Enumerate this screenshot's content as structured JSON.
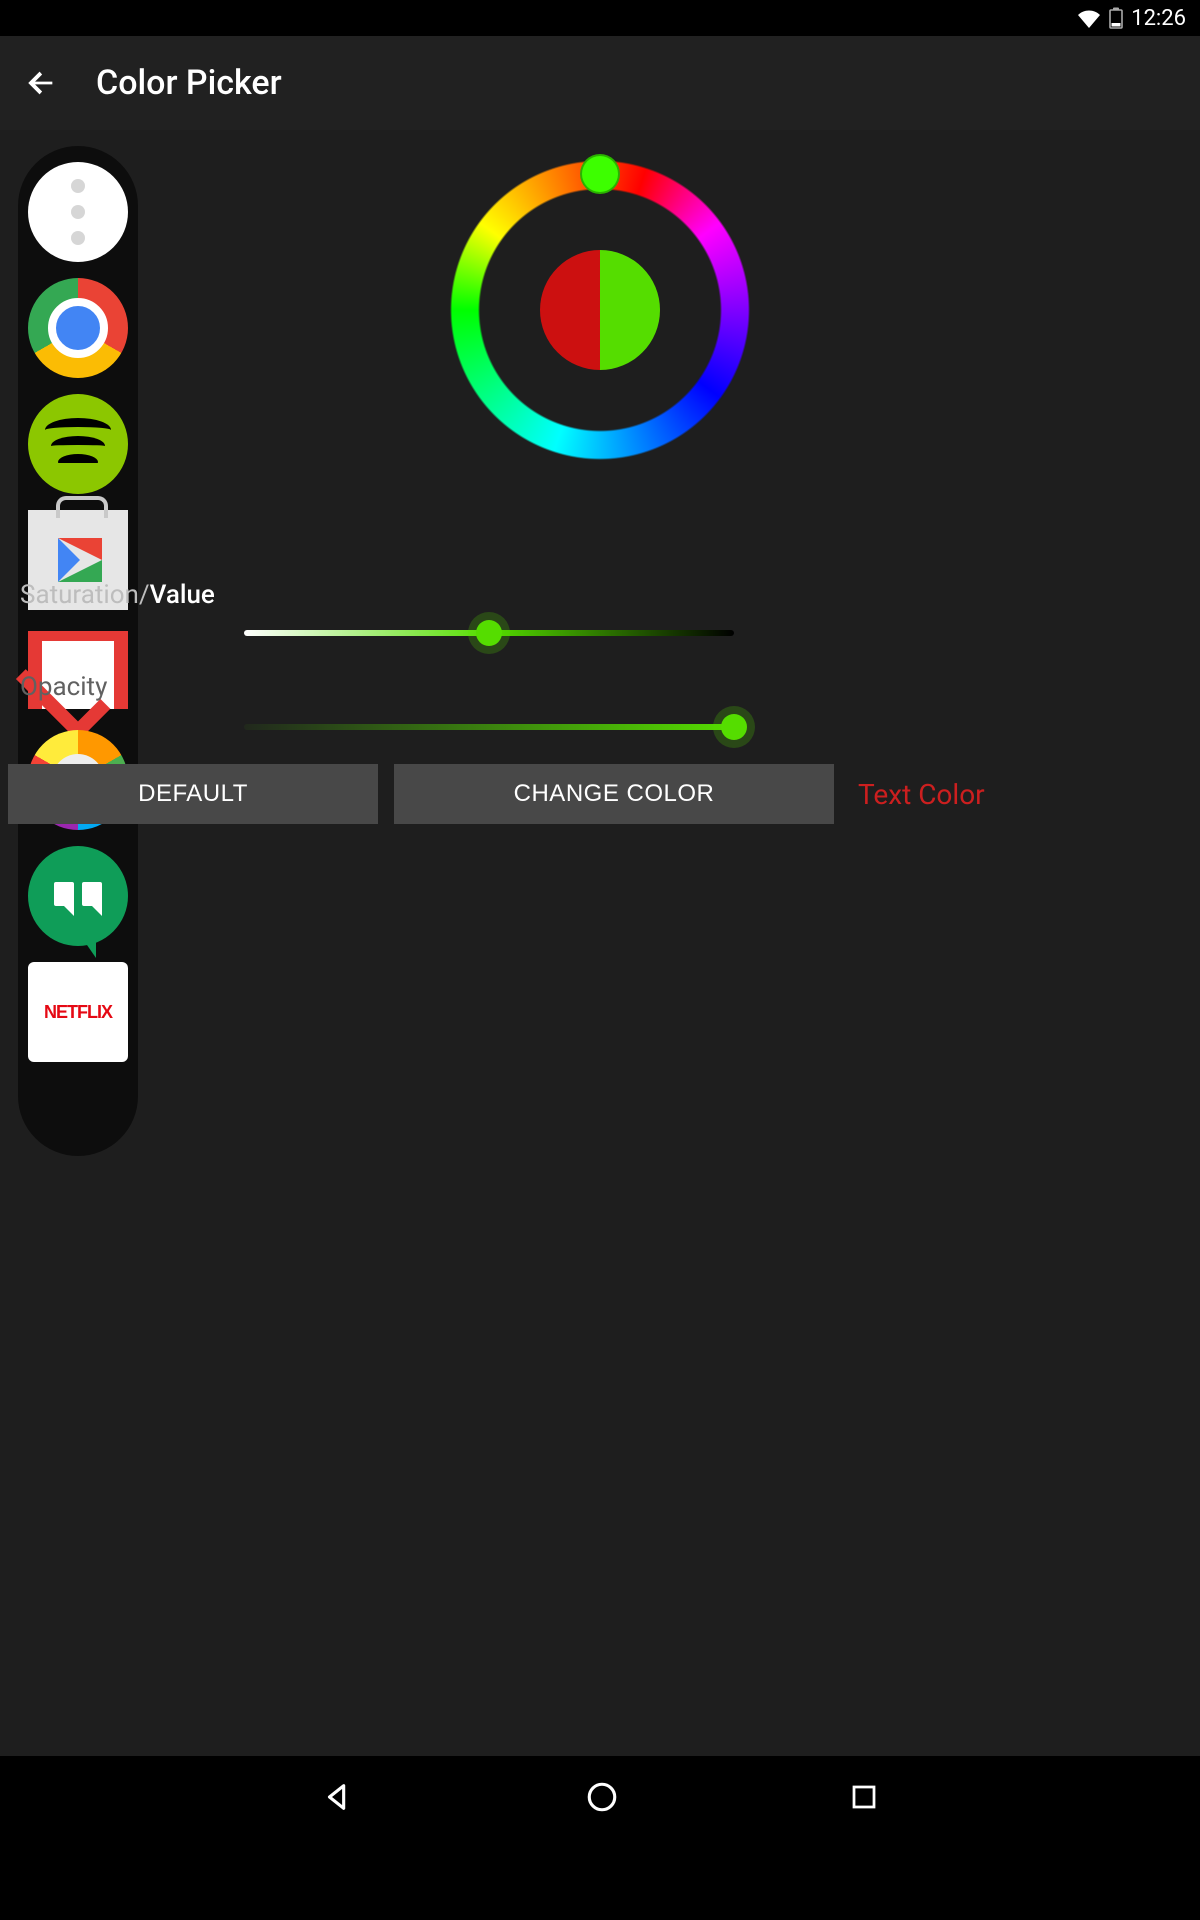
{
  "status": {
    "time": "12:26"
  },
  "header": {
    "title": "Color Picker"
  },
  "labels": {
    "saturation": "Saturation",
    "value": "Value",
    "opacity": "Opacity",
    "text_color": "Text Color"
  },
  "buttons": {
    "default": "DEFAULT",
    "change": "CHANGE COLOR"
  },
  "colors": {
    "old": "#cc1010",
    "new": "#55dd00",
    "accent": "#55dd00"
  },
  "sliders": {
    "sv_percent": 50,
    "opacity_percent": 100
  },
  "sidebar": {
    "items": [
      {
        "name": "dots-menu"
      },
      {
        "name": "chrome"
      },
      {
        "name": "spotify"
      },
      {
        "name": "play-store"
      },
      {
        "name": "gmail"
      },
      {
        "name": "trivia-crack"
      },
      {
        "name": "hangouts"
      },
      {
        "name": "netflix",
        "label": "NETFLIX"
      }
    ]
  }
}
